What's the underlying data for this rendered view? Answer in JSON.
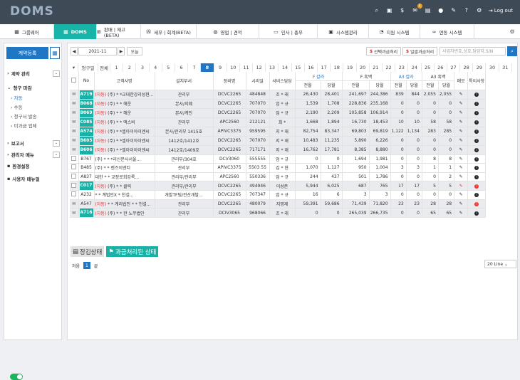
{
  "app": {
    "logo": "DOMS",
    "logout": "Log out",
    "mail_badge": "1"
  },
  "menu": [
    {
      "label": "그룹웨어",
      "icon": "grid-icon"
    },
    {
      "label": "DOMS",
      "icon": "grid-icon",
      "active": true
    },
    {
      "label": "판매 | 재고(BETA)",
      "icon": "cart-icon"
    },
    {
      "label": "세무 | 회계(BETA)",
      "icon": "won-icon"
    },
    {
      "label": "영업 | 견적",
      "icon": "globe-icon"
    },
    {
      "label": "인사 | 총무",
      "icon": "card-icon"
    },
    {
      "label": "시스템관리",
      "icon": "monitor-icon"
    },
    {
      "label": "지원 시스템",
      "icon": "headset-icon"
    },
    {
      "label": "연동 시스템",
      "icon": "link-icon"
    }
  ],
  "sidebar": {
    "register": "계약등록",
    "items": [
      {
        "label": "계약 관리",
        "bold": true
      },
      {
        "label": "청구 마감",
        "bold": true
      },
      {
        "label": "자동",
        "sub": true,
        "active": true
      },
      {
        "label": "수동",
        "sub": true
      },
      {
        "label": "청구서 발송",
        "sub": true
      },
      {
        "label": "미과금 업체",
        "sub": true
      },
      {
        "label": "보고서",
        "bold": true
      },
      {
        "label": "관리자 메뉴",
        "bold": true
      },
      {
        "label": "환경설정",
        "bold": true
      },
      {
        "label": "사용자 매뉴얼",
        "bold": true
      }
    ]
  },
  "toolbar": {
    "month": "2021-11",
    "today": "오늘",
    "selected_billing": "선택과금처리",
    "bulk_billing": "일괄과금처리",
    "search_placeholder": "사업자번호,상호,담당자,S/N"
  },
  "days": {
    "label": "청구일",
    "all": "전체",
    "list": [
      "1",
      "2",
      "3",
      "4",
      "5",
      "6",
      "7",
      "8",
      "9",
      "10",
      "11",
      "12",
      "13",
      "14",
      "15",
      "16",
      "17",
      "18",
      "19",
      "20",
      "21",
      "22",
      "23",
      "24",
      "25",
      "26",
      "27",
      "28",
      "29",
      "30",
      "31"
    ],
    "selected": "8"
  },
  "table": {
    "headers": {
      "no": "No",
      "customer": "고객사명",
      "dept": "설치부서",
      "model": "장비명",
      "serial": "시리얼",
      "service": "서비스담당",
      "fcolor": "F 칼라",
      "fbw": "F 흑백",
      "a3color": "A3 칼라",
      "a3bw": "A3 흑백",
      "memo": "메모",
      "special": "특이사항",
      "prev": "전월",
      "cur": "당월"
    },
    "rows": [
      {
        "no": "A719",
        "badge": true,
        "gray": true,
        "checked": true,
        "cust": "(자동) (주) * *교대한강리성현...",
        "dept": "관리부",
        "model": "DCVC2265",
        "serial": "484848",
        "svc": "조 * 래",
        "v": [
          "26,430",
          "28,401",
          "241,697",
          "244,386",
          "839",
          "844",
          "2,055",
          "2,055"
        ],
        "info": "black"
      },
      {
        "no": "B068",
        "badge": true,
        "gray": true,
        "checked": true,
        "cust": "(자동) (주) * * 해운",
        "dept": "본사/지혜",
        "model": "DCVC2265",
        "serial": "707070",
        "svc": "엄 * 규",
        "v": [
          "1,539",
          "1,708",
          "228,836",
          "235,168",
          "0",
          "0",
          "0",
          "0"
        ],
        "info": "black"
      },
      {
        "no": "B069",
        "badge": true,
        "gray": true,
        "checked": true,
        "cust": "(자동) (주) * * 해운",
        "dept": "본사/계인",
        "model": "DCVC2265",
        "serial": "707070",
        "svc": "엄 * 규",
        "v": [
          "2,190",
          "2,209",
          "105,858",
          "106,914",
          "0",
          "0",
          "0",
          "0"
        ],
        "info": "black"
      },
      {
        "no": "C085",
        "badge": true,
        "gray": true,
        "checked": true,
        "cust": "(자동) (주) * * 액스비",
        "dept": "관리부",
        "model": "APC2560",
        "serial": "212121",
        "svc": "최 *",
        "v": [
          "1,668",
          "1,894",
          "16,730",
          "18,453",
          "10",
          "10",
          "58",
          "58"
        ],
        "info": "black"
      },
      {
        "no": "A574",
        "badge": true,
        "gray": true,
        "checked": true,
        "cust": "(자동) (주) * *엘아이아이엔씨",
        "dept": "본사/관리부 1415호",
        "model": "APIVC3375",
        "serial": "959595",
        "svc": "지 * 재",
        "v": [
          "82,754",
          "83,347",
          "69,803",
          "69,819",
          "1,122",
          "1,134",
          "283",
          "285"
        ],
        "info": "black"
      },
      {
        "no": "B605",
        "badge": true,
        "gray": true,
        "checked": true,
        "cust": "(자동) (주) * *엘아이아이엔씨",
        "dept": "1412호/1412호",
        "model": "DCVC2265",
        "serial": "707070",
        "svc": "지 * 재",
        "v": [
          "10,483",
          "11,235",
          "5,890",
          "6,226",
          "0",
          "0",
          "0",
          "0"
        ],
        "info": "black"
      },
      {
        "no": "B606",
        "badge": true,
        "gray": true,
        "checked": true,
        "cust": "(자동) (주) * *엘아이아이엔씨",
        "dept": "1412호/1409호",
        "model": "DCVC2265",
        "serial": "717171",
        "svc": "지 * 재",
        "v": [
          "16,762",
          "17,781",
          "8,385",
          "8,880",
          "0",
          "0",
          "0",
          "0"
        ],
        "info": "black"
      },
      {
        "no": "B767",
        "badge": false,
        "gray": false,
        "checked": false,
        "cust": "(주) * * *리신문사서울...",
        "dept": "관리부/304호",
        "model": "DCV3060",
        "serial": "555555",
        "svc": "엄 * 규",
        "v": [
          "0",
          "0",
          "1,694",
          "1,981",
          "0",
          "0",
          "8",
          "8"
        ],
        "info": "black"
      },
      {
        "no": "B485",
        "badge": false,
        "gray": false,
        "checked": false,
        "cust": "(주) * * 렌즈이엔티",
        "dept": "관리부",
        "model": "APIVC3375",
        "serial": "5503 55",
        "svc": "김 * 현",
        "v": [
          "1,070",
          "1,127",
          "950",
          "1,004",
          "3",
          "3",
          "1",
          "1"
        ],
        "info": "black"
      },
      {
        "no": "A837",
        "badge": false,
        "gray": false,
        "checked": false,
        "cust": "대한 * * 교장로회강록...",
        "dept": "관리부/관리부",
        "model": "APC2560",
        "serial": "550336",
        "svc": "엄 * 규",
        "v": [
          "244",
          "437",
          "501",
          "1,786",
          "0",
          "0",
          "0",
          "2"
        ],
        "info": "black"
      },
      {
        "no": "C017",
        "badge": true,
        "gray": true,
        "checked": false,
        "cust": "(자동) (주) * * 클릭",
        "dept": "관리부/관리부",
        "model": "DCVC2265",
        "serial": "494946",
        "svc": "이성준",
        "v": [
          "5,944",
          "6,025",
          "687",
          "765",
          "17",
          "17",
          "5",
          "5"
        ],
        "info": "red",
        "memo": true
      },
      {
        "no": "A232",
        "badge": false,
        "gray": false,
        "checked": false,
        "cust": "* * 계법인X * 천설...",
        "dept": "개발TF팀/전산개발...",
        "model": "DCVC2265",
        "serial": "707347",
        "svc": "엄 * 규",
        "v": [
          "16",
          "6",
          "3",
          "3",
          "0",
          "0",
          "0",
          "0"
        ],
        "info": "black"
      },
      {
        "no": "A547",
        "badge": false,
        "gray": true,
        "checked": true,
        "cust": "(자동) * * 계리법인 * * 천설...",
        "dept": "관리부",
        "model": "DCVC2265",
        "serial": "480079",
        "svc": "지영재",
        "v": [
          "59,391",
          "59,686",
          "71,439",
          "71,820",
          "23",
          "23",
          "28",
          "28"
        ],
        "info": "red"
      },
      {
        "no": "A716",
        "badge": true,
        "gray": true,
        "checked": true,
        "cust": "(자동) (주) * * 한 노무법인",
        "dept": "관리부",
        "model": "DCIV3065",
        "serial": "968066",
        "svc": "조 * 래",
        "v": [
          "0",
          "0",
          "265,039",
          "266,735",
          "0",
          "0",
          "65",
          "65"
        ],
        "info": "black"
      }
    ]
  },
  "legend": {
    "locked": "장김상태",
    "billed": "과금처리된 상태"
  },
  "pager": {
    "first": "처음",
    "page": "1",
    "last": "끝",
    "lines": "20 Line"
  }
}
